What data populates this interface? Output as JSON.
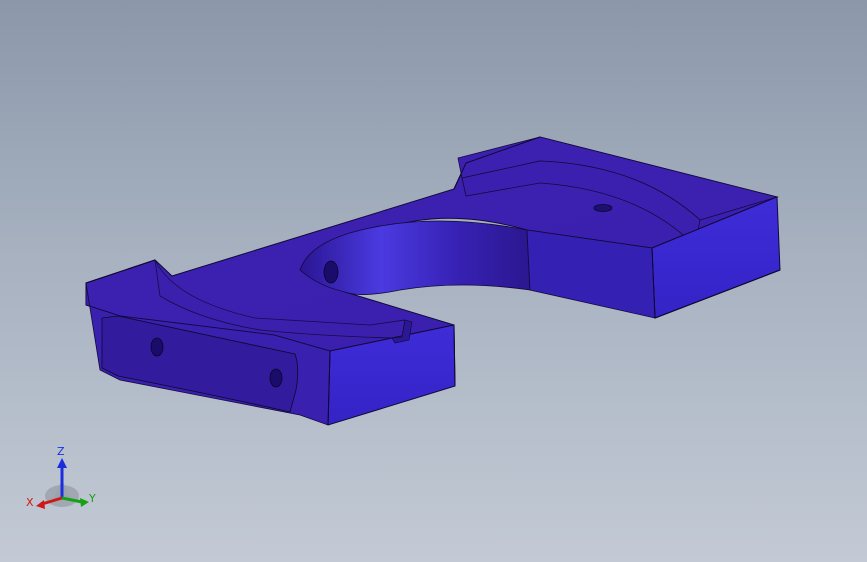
{
  "viewport": {
    "background_top": "#8b98aa",
    "background_bottom": "#c3cad5"
  },
  "model": {
    "color": "#3a1fb0",
    "color_light": "#4a34d6",
    "color_dark": "#2c1690",
    "edge_color": "#0e0830"
  },
  "triad": {
    "x_label": "X",
    "y_label": "Y",
    "z_label": "Z",
    "x_color": "#d01818",
    "y_color": "#18a018",
    "z_color": "#1a2ee0"
  }
}
